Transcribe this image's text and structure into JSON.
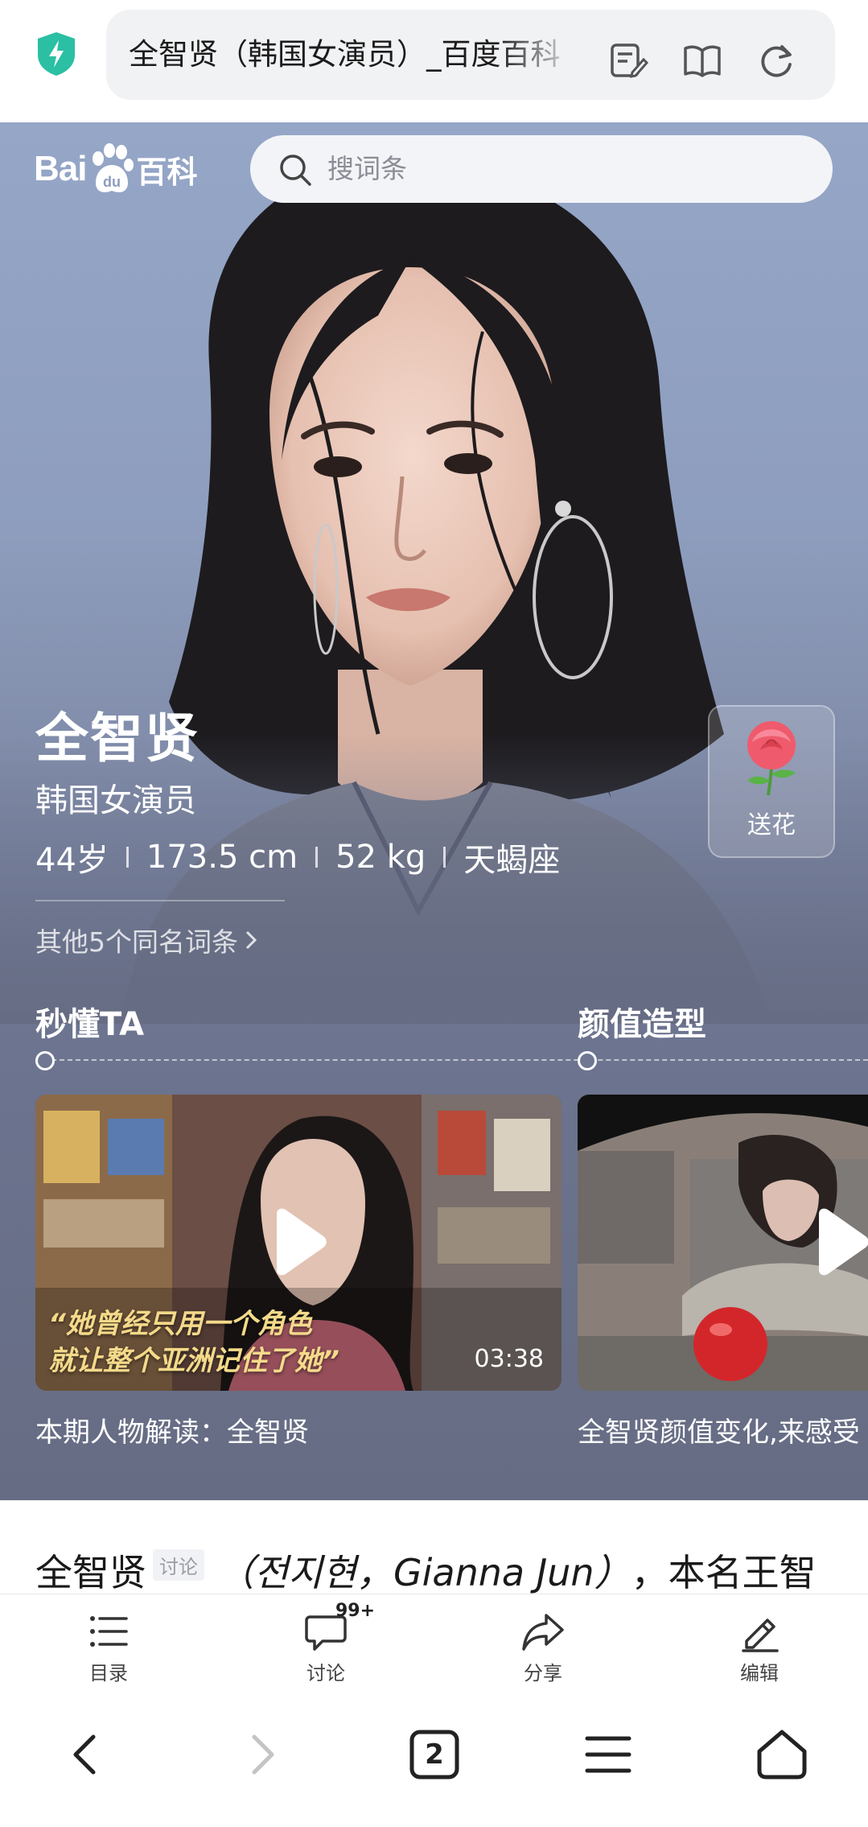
{
  "browser": {
    "url_title": "全智贤（韩国女演员）_百度百科"
  },
  "header": {
    "logo_bai": "Bai",
    "logo_baike": "百科",
    "search_placeholder": "搜词条"
  },
  "person": {
    "name": "全智贤",
    "subtitle": "韩国女演员",
    "stats": [
      "44岁",
      "173.5 cm",
      "52 kg",
      "天蝎座"
    ],
    "same_name_link": "其他5个同名词条"
  },
  "flower": {
    "label": "送花"
  },
  "sections": [
    {
      "title": "秒懂TA"
    },
    {
      "title": "颜值造型"
    }
  ],
  "videos": [
    {
      "title": "本期人物解读：全智贤",
      "duration": "03:38",
      "quote_line1": "“她曾经只用一个角色",
      "quote_line2": "就让整个亚洲记住了她”"
    },
    {
      "title": "全智贤颜值变化,来感受"
    }
  ],
  "article": {
    "name": "全智贤",
    "tag": "讨论",
    "alt_names": "（전지현，Gianna Jun）",
    "rest": "，本名王智"
  },
  "toolbar": {
    "items": [
      {
        "label": "目录"
      },
      {
        "label": "讨论",
        "badge": "99+"
      },
      {
        "label": "分享"
      },
      {
        "label": "编辑"
      }
    ]
  },
  "nav": {
    "tab_count": "2"
  }
}
